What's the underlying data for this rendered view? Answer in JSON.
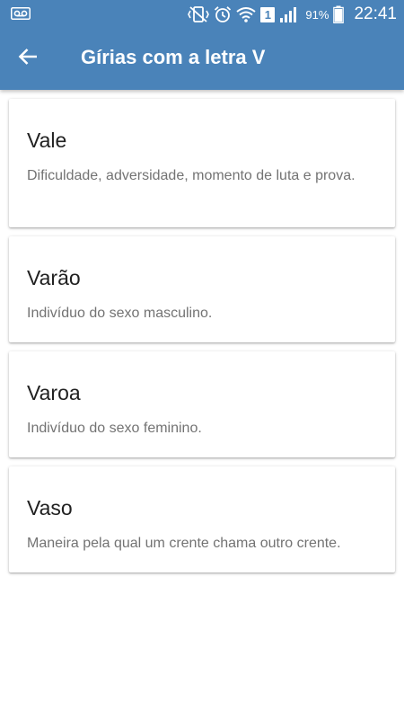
{
  "status_bar": {
    "battery_percent": "91%",
    "time": "22:41",
    "sim_number": "1",
    "icons": [
      "voicemail-icon",
      "vibrate-icon",
      "alarm-icon",
      "wifi-icon",
      "sim-icon",
      "signal-icon",
      "battery-icon"
    ]
  },
  "appbar": {
    "title": "Gírias com a letra V",
    "back_icon": "arrow-back-icon",
    "color": "#4a83b9"
  },
  "entries": [
    {
      "term": "Vale",
      "definition": "Dificuldade, adversidade, momento de luta e prova."
    },
    {
      "term": "Varão",
      "definition": "Indivíduo do sexo masculino."
    },
    {
      "term": "Varoa",
      "definition": "Indivíduo do sexo feminino."
    },
    {
      "term": "Vaso",
      "definition": "Maneira pela qual um crente chama outro crente."
    }
  ]
}
